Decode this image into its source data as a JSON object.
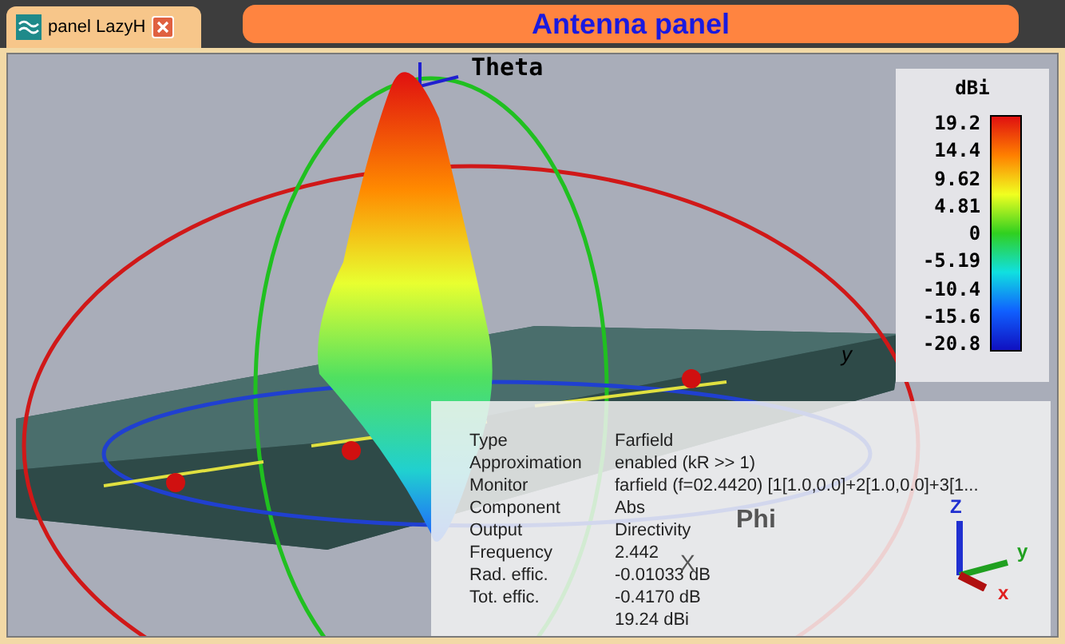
{
  "tab": {
    "label": "panel LazyH",
    "selected": true
  },
  "banner": {
    "title": "Antenna panel"
  },
  "scene": {
    "labels": [
      {
        "kind": "theta",
        "text": "Theta"
      },
      {
        "kind": "y",
        "text": "y"
      },
      {
        "kind": "phi",
        "text": "Phi"
      },
      {
        "kind": "x",
        "text": "X"
      }
    ]
  },
  "legend": {
    "unit": "dBi",
    "ticks": [
      "19.2",
      "14.4",
      "9.62",
      "4.81",
      "0",
      "-5.19",
      "-10.4",
      "-15.6",
      "-20.8"
    ]
  },
  "info": {
    "rows": [
      {
        "label": "Type",
        "value": "Farfield"
      },
      {
        "label": "Approximation",
        "value": "enabled (kR >> 1)"
      },
      {
        "label": "Monitor",
        "value": "farfield (f=02.4420) [1[1.0,0.0]+2[1.0,0.0]+3[1..."
      },
      {
        "label": "Component",
        "value": "Abs"
      },
      {
        "label": "Output",
        "value": "Directivity"
      },
      {
        "label": "Frequency",
        "value": "2.442"
      },
      {
        "label": "Rad. effic.",
        "value": "-0.01033 dB"
      },
      {
        "label": "Tot. effic.",
        "value": "-0.4170 dB"
      },
      {
        "value": "19.24 dBi"
      }
    ]
  },
  "triad": {
    "z": "Z",
    "y": "y",
    "x": "x"
  }
}
